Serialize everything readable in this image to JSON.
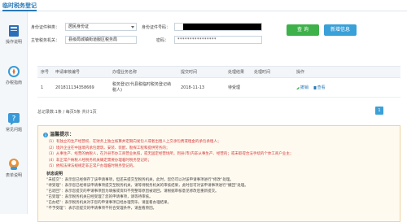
{
  "page": {
    "title": "临时税务登记"
  },
  "sidebar": {
    "items": [
      {
        "label": "操作说明",
        "icon": "book-icon"
      },
      {
        "label": "办税指南",
        "icon": "compass-icon"
      },
      {
        "label": "常见问题",
        "icon": "question-icon"
      },
      {
        "label": "表单说明",
        "icon": "support-icon"
      }
    ]
  },
  "form": {
    "id_type_label": "身份证件种类：",
    "id_type_value": "居民身份证",
    "id_number_label": "身份证件号码：",
    "authority_label": "主管税务机关：",
    "authority_value": "县级局城镇街道服区税务局",
    "password_label": "密码：",
    "password_value": "****************",
    "query_button": "查  询",
    "add_button": "新增信息"
  },
  "table": {
    "headers": [
      "序号",
      "申请审核编号",
      "办理业务名称",
      "提交时间",
      "处理结果",
      "处理时间",
      "操作"
    ],
    "rows": [
      {
        "index": "1",
        "app_no": "201811134358669",
        "business": "税务登记(代县税临时税务登记纳税人)",
        "submit_time": "2018-11-13",
        "result": "待受理",
        "process_time": "",
        "op_delete": "撤销",
        "op_view": "查看"
      }
    ]
  },
  "pager": {
    "summary": "总记录数:1条 / 每页5条 共计1页",
    "current_page": "1"
  },
  "notice": {
    "title": "温馨提示：",
    "items": [
      "（1）有独立的生产经营权、在财务上独立核算并定期向发包人或者出租人上交承包费或租金的承包承租人；",
      "（2）境外企业在中国境内承包建筑、安装、装配、勘探工程和提供劳务的；",
      "（3）从事生产、经营的纳税人，在外县市办工商营业执照，或无固定经营场所，到县(市)内非从事生产、经营的；或未取得合法手续的个体工商户业主；",
      "（4）非正常户纳税人经税务机关确定需要办理临时税务登记的；",
      "（5）依照法律法规规定非正常户办理临时税务登记的。"
    ],
    "status_title": "状态说明",
    "statuses": [
      "“未提交”：表示您已经保存了该申请事项，但还未提交至税务机关，此时，您仍可以对该申请事项进行“修改”处理。",
      "“待受理”：表示您已经将该申请事项提交至税务机关，请等待税务机关的审核结果，此时您可对该申请事项进行“撤回”处理。",
      "“已退回”：表示您提交的申请事项因为填报或资料不完整等原因被退回，请根据审核意见修改后重新提交。",
      "“已受理”：表示税务机关已经受理了您的申请事项，请等待审核。",
      "“已办结”：表示税务机关对于您的申请事项已经办理完毕，请查看办理结果。",
      "“不予受理”：表示您提交的申请事项不符合受理条件，请查看原因。"
    ]
  },
  "colors": {
    "accent": "#2a7ab8",
    "green": "#3eb14a",
    "blue": "#3aa0d8",
    "warning": "#d23a3a"
  }
}
